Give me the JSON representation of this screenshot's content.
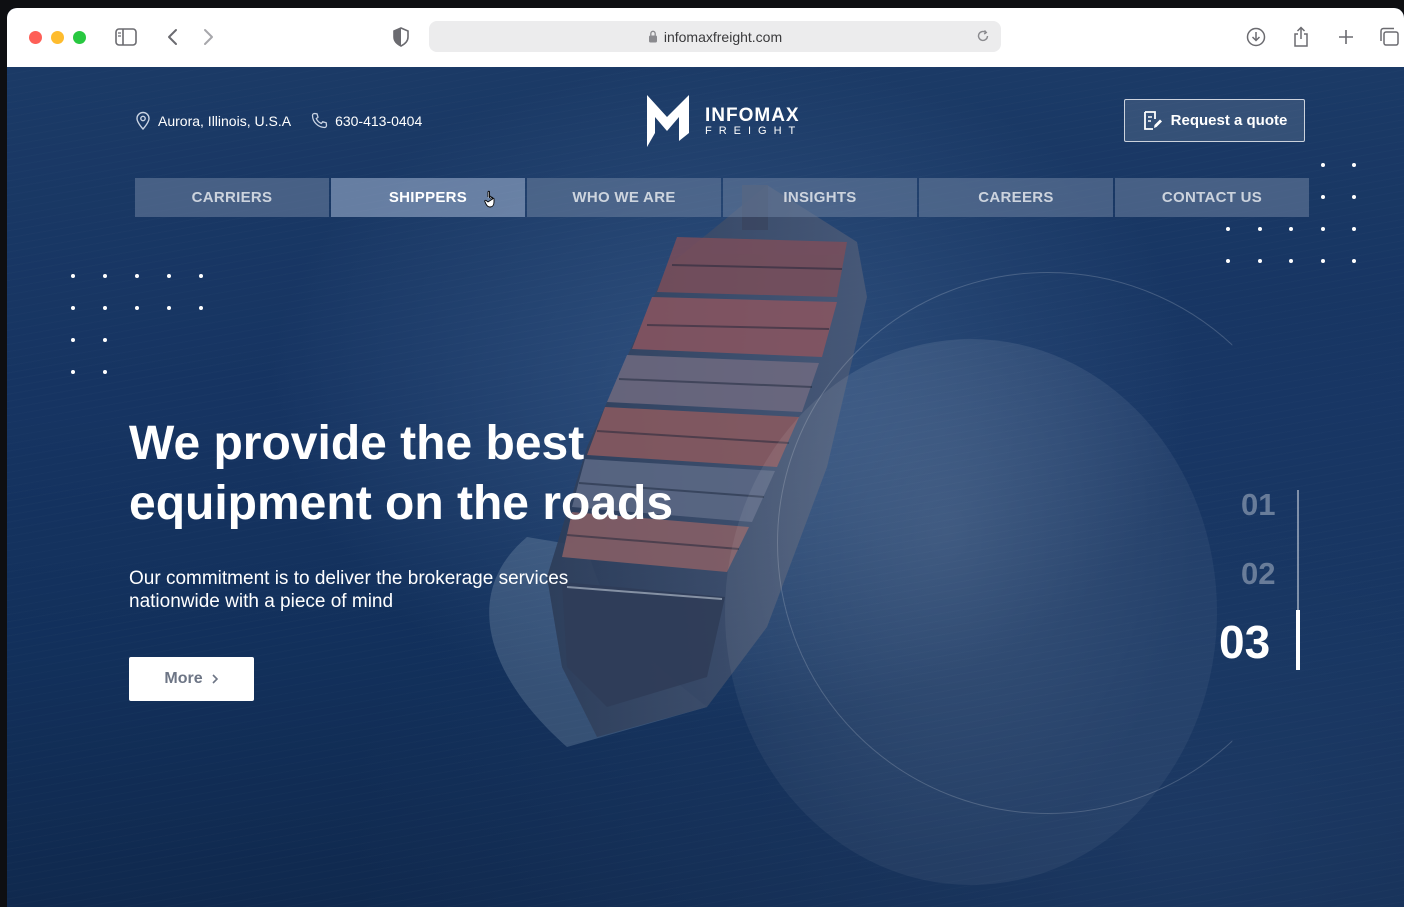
{
  "browser": {
    "url": "infomaxfreight.com"
  },
  "header": {
    "location": "Aurora, Illinois, U.S.A",
    "phone": "630-413-0404",
    "logo_main": "INFOMAX",
    "logo_sub": "FREIGHT",
    "quote_button": "Request a quote"
  },
  "nav": {
    "items": [
      {
        "label": "CARRIERS"
      },
      {
        "label": "SHIPPERS"
      },
      {
        "label": "WHO WE ARE"
      },
      {
        "label": "INSIGHTS"
      },
      {
        "label": "CAREERS"
      },
      {
        "label": "CONTACT US"
      }
    ],
    "active_index": 1
  },
  "hero": {
    "title_line1": "We provide the best",
    "title_line2": "equipment on the roads",
    "subtitle_line1": "Our commitment is to deliver the brokerage services",
    "subtitle_line2": "nationwide with a piece of mind",
    "more_button": "More"
  },
  "slider": {
    "numbers": [
      "01",
      "02",
      "03"
    ],
    "active_index": 2
  },
  "colors": {
    "page_bg": "#12305b",
    "nav_bg": "#6e82a0",
    "accent_white": "#ffffff"
  }
}
